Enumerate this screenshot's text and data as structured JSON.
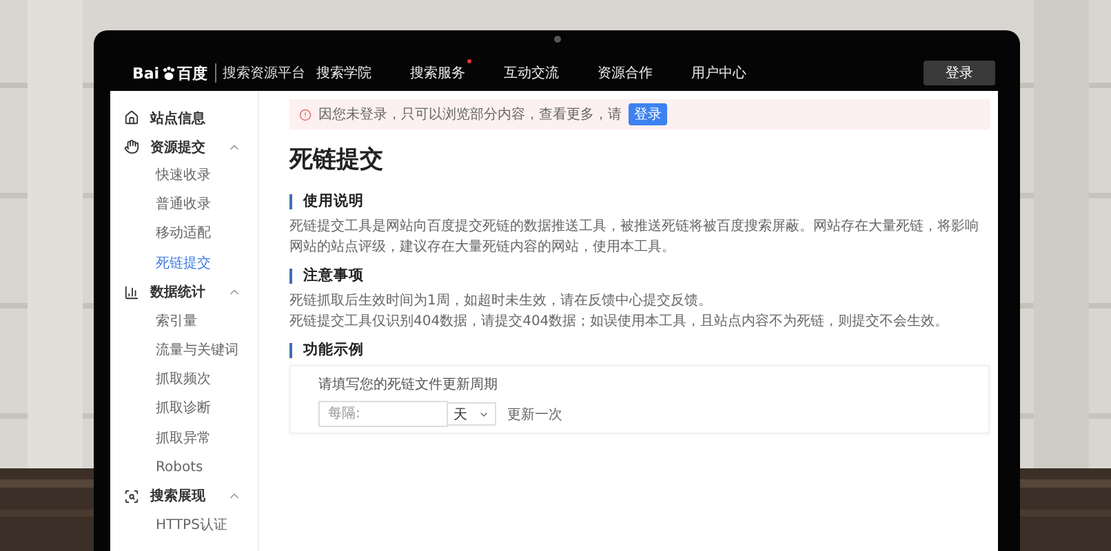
{
  "nav": {
    "logo": {
      "latin": "Bai",
      "chinese": "百度"
    },
    "platform": "搜索资源平台",
    "items": [
      {
        "label": "搜索学院",
        "badge": false
      },
      {
        "label": "搜索服务",
        "badge": true
      },
      {
        "label": "互动交流",
        "badge": false
      },
      {
        "label": "资源合作",
        "badge": false
      },
      {
        "label": "用户中心",
        "badge": false
      }
    ],
    "login": "登录"
  },
  "sidebar": {
    "groups": [
      {
        "kind": "home",
        "label": "站点信息"
      },
      {
        "kind": "submit",
        "label": "资源提交",
        "expanded": true,
        "children": [
          {
            "label": "快速收录",
            "selected": false
          },
          {
            "label": "普通收录",
            "selected": false
          },
          {
            "label": "移动适配",
            "selected": false
          },
          {
            "label": "死链提交",
            "selected": true
          }
        ]
      },
      {
        "kind": "stats",
        "label": "数据统计",
        "expanded": true,
        "children": [
          {
            "label": "索引量",
            "selected": false
          },
          {
            "label": "流量与关键词",
            "selected": false
          },
          {
            "label": "抓取频次",
            "selected": false
          },
          {
            "label": "抓取诊断",
            "selected": false
          },
          {
            "label": "抓取异常",
            "selected": false
          },
          {
            "label": "Robots",
            "selected": false
          }
        ]
      },
      {
        "kind": "display",
        "label": "搜索展现",
        "expanded": true,
        "children": [
          {
            "label": "HTTPS认证",
            "selected": false
          }
        ]
      }
    ]
  },
  "main": {
    "notice": {
      "text": "因您未登录，只可以浏览部分内容，查看更多，请",
      "button": "登录"
    },
    "title": "死链提交",
    "sections": [
      {
        "kind": "text",
        "heading": "使用说明",
        "paragraphs": [
          "死链提交工具是网站向百度提交死链的数据推送工具，被推送死链将被百度搜索屏蔽。网站存在大量死链，将影响网站的站点评级，建议存在大量死链内容的网站，使用本工具。"
        ]
      },
      {
        "kind": "text",
        "heading": "注意事项",
        "paragraphs": [
          "死链抓取后生效时间为1周，如超时未生效，请在反馈中心提交反馈。",
          "死链提交工具仅识别404数据，请提交404数据；如误使用本工具，且站点内容不为死链，则提交不会生效。"
        ]
      },
      {
        "kind": "form",
        "heading": "功能示例",
        "label": "请填写您的死链文件更新周期",
        "input": {
          "placeholder": "每隔:"
        },
        "select": {
          "value": "天"
        },
        "suffix": "更新一次"
      }
    ]
  }
}
